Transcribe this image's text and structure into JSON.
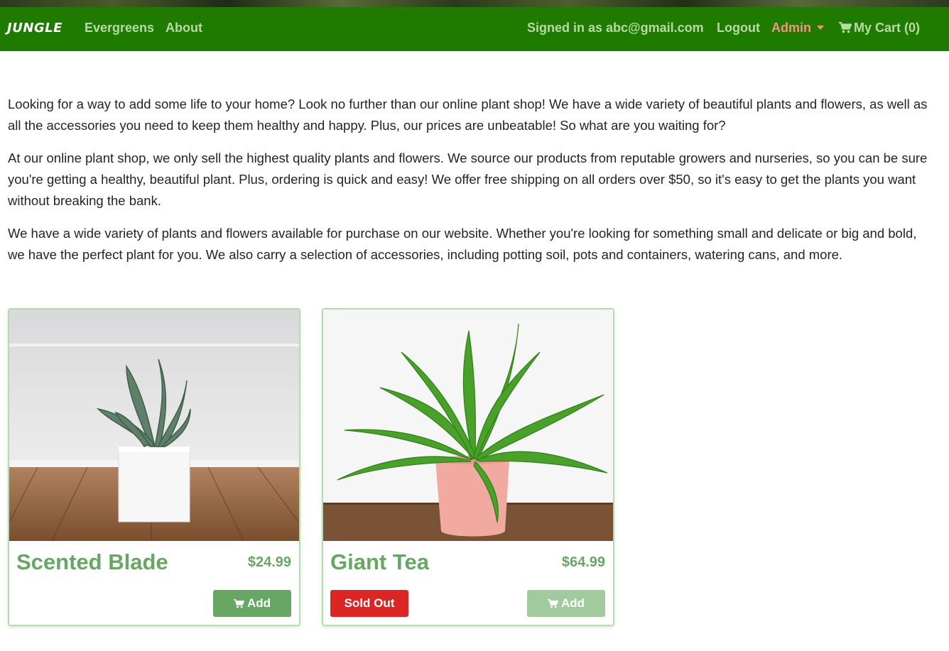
{
  "navbar": {
    "brand": "JUNGLE",
    "links": {
      "evergreens": "Evergreens",
      "about": "About"
    },
    "signed_in": "Signed in as abc@gmail.com",
    "logout": "Logout",
    "admin": "Admin",
    "cart": "My Cart (0)",
    "colors": {
      "background": "#1f7a00",
      "link": "#b9d9a6",
      "admin": "#f0967e"
    }
  },
  "intro": {
    "paragraphs": [
      "Looking for a way to add some life to your home? Look no further than our online plant shop! We have a wide variety of beautiful plants and flowers, as well as all the accessories you need to keep them healthy and happy. Plus, our prices are unbeatable! So what are you waiting for?",
      "At our online plant shop, we only sell the highest quality plants and flowers. We source our products from reputable growers and nurseries, so you can be sure you're getting a healthy, beautiful plant. Plus, ordering is quick and easy! We offer free shipping on all orders over $50, so it's easy to get the plants you want without breaking the bank.",
      "We have a wide variety of plants and flowers available for purchase on our website. Whether you're looking for something small and delicate or big and bold, we have the perfect plant for you. We also carry a selection of accessories, including potting soil, pots and containers, watering cans, and more."
    ]
  },
  "products": [
    {
      "name": "Scented Blade",
      "price": "$24.99",
      "add_label": "Add",
      "sold_out": false,
      "image_icon": "succulent-in-white-pot"
    },
    {
      "name": "Giant Tea",
      "price": "$64.99",
      "add_label": "Add",
      "sold_out": true,
      "sold_out_label": "Sold Out",
      "image_icon": "fern-in-pink-pot"
    }
  ],
  "colors": {
    "accent": "#68a664",
    "accent_disabled": "#a1cb9e",
    "sold_out": "#dc2626",
    "card_border": "#b6dcae"
  }
}
